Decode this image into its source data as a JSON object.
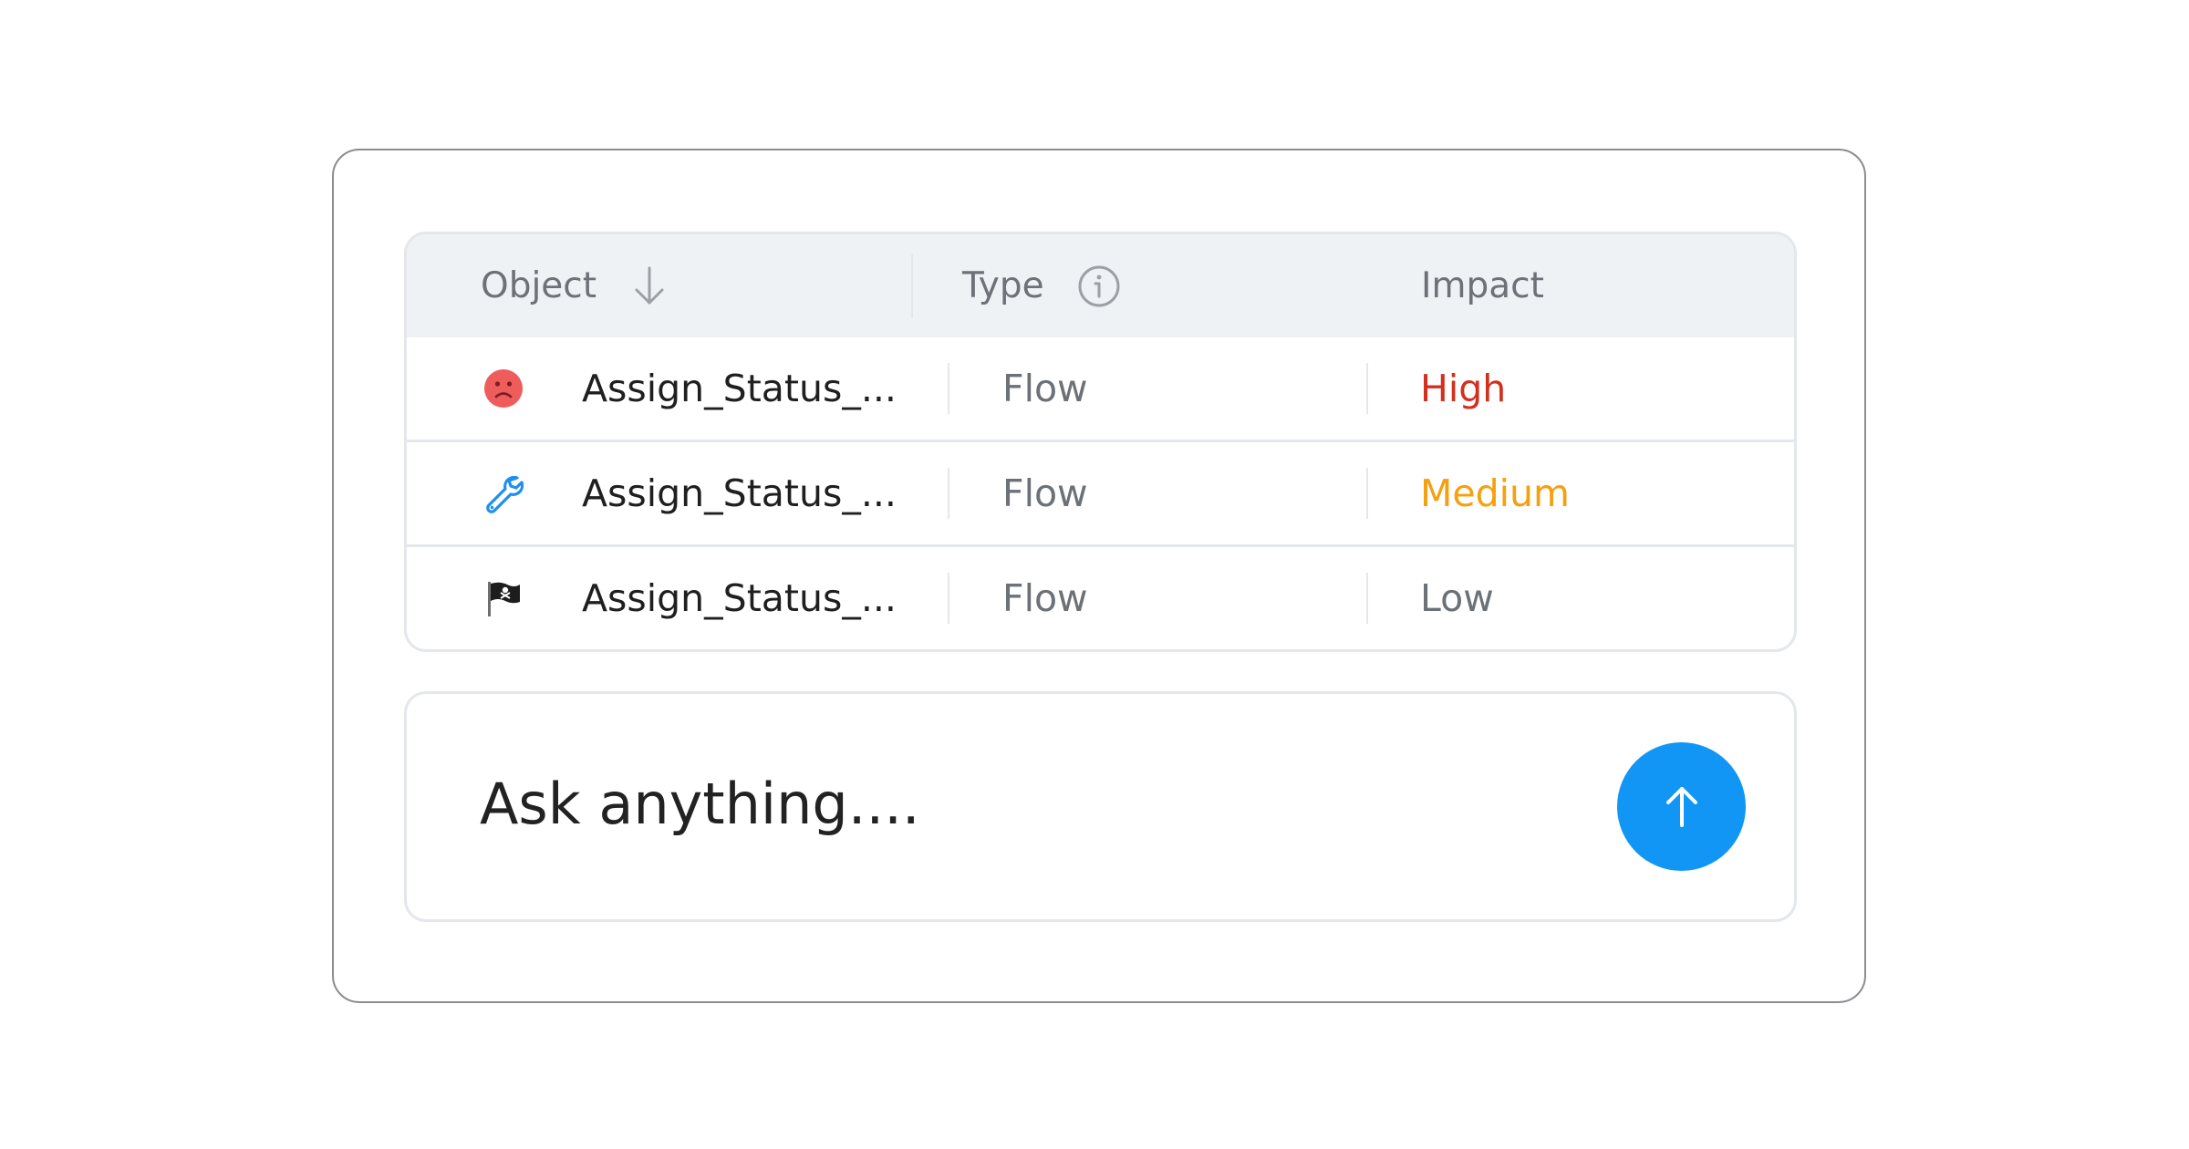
{
  "table": {
    "columns": [
      {
        "label": "Object",
        "icon": "arrow-down-icon"
      },
      {
        "label": "Type",
        "icon": "info-icon"
      },
      {
        "label": "Impact"
      }
    ],
    "rows": [
      {
        "icon": "sad-face-icon",
        "object": "Assign_Status_...",
        "type": "Flow",
        "impact": "High",
        "impact_color": "#d2301f"
      },
      {
        "icon": "wrench-icon",
        "object": "Assign_Status_...",
        "type": "Flow",
        "impact": "Medium",
        "impact_color": "#f5a00f"
      },
      {
        "icon": "pirate-flag-icon",
        "object": "Assign_Status_...",
        "type": "Flow",
        "impact": "Low",
        "impact_color": "#6b7176"
      }
    ]
  },
  "composer": {
    "placeholder": "Ask anything....",
    "send_icon": "arrow-up-icon",
    "send_color": "#1196f5"
  }
}
